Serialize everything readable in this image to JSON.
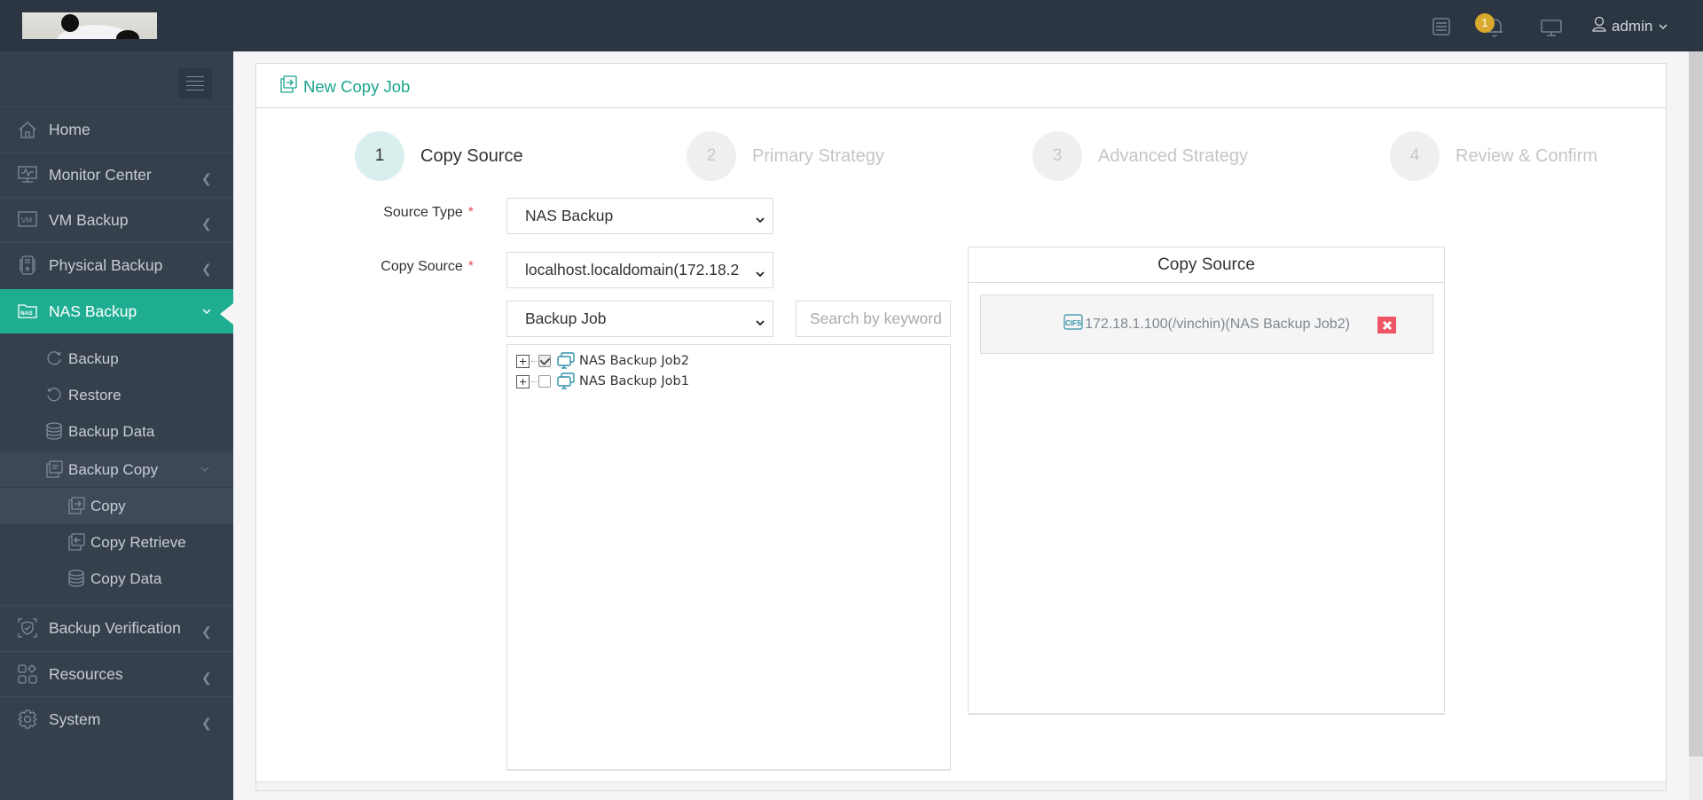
{
  "header": {
    "logo_alt": "panda logo",
    "notification_count": "1",
    "user_name": "admin",
    "icons": [
      "task-list-icon",
      "bell-icon",
      "monitor-icon",
      "user-icon",
      "chevron-down-icon"
    ]
  },
  "sidebar": {
    "items": [
      {
        "label": "Home",
        "icon": "home-icon"
      },
      {
        "label": "Monitor Center",
        "icon": "monitor-chart-icon"
      },
      {
        "label": "VM Backup",
        "icon": "vm-icon"
      },
      {
        "label": "Physical Backup",
        "icon": "server-icon"
      },
      {
        "label": "NAS Backup",
        "icon": "nas-icon",
        "active": true
      },
      {
        "label": "Backup Verification",
        "icon": "shield-check-icon"
      },
      {
        "label": "Resources",
        "icon": "grid-icon"
      },
      {
        "label": "System",
        "icon": "gear-icon"
      }
    ],
    "nas_sub": [
      {
        "label": "Backup",
        "icon": "refresh-icon"
      },
      {
        "label": "Restore",
        "icon": "undo-icon"
      },
      {
        "label": "Backup Data",
        "icon": "database-icon"
      },
      {
        "label": "Backup Copy",
        "icon": "copy-icon"
      }
    ],
    "copy_sub": [
      {
        "label": "Copy",
        "icon": "copy-arrow-icon",
        "current": true
      },
      {
        "label": "Copy Retrieve",
        "icon": "copy-retrieve-icon"
      },
      {
        "label": "Copy Data",
        "icon": "database-icon"
      }
    ]
  },
  "page": {
    "title": "New Copy Job",
    "steps": [
      {
        "number": "1",
        "label": "Copy Source",
        "active": true
      },
      {
        "number": "2",
        "label": "Primary Strategy"
      },
      {
        "number": "3",
        "label": "Advanced Strategy"
      },
      {
        "number": "4",
        "label": "Review & Confirm"
      }
    ],
    "form": {
      "source_type_label": "Source Type",
      "source_type_value": "NAS Backup",
      "copy_source_label": "Copy Source",
      "copy_source_value": "localhost.localdomain(172.18.2",
      "filter_value": "Backup Job",
      "search_placeholder": "Search by keyword",
      "required_mark": "*"
    },
    "tree": [
      {
        "label": "NAS Backup Job2",
        "checked": true
      },
      {
        "label": "NAS Backup Job1",
        "checked": false
      }
    ],
    "selected_panel": {
      "title": "Copy Source",
      "items": [
        {
          "icon": "cifs-icon",
          "text": "172.18.1.100(/vinchin)(NAS Backup Job2)"
        }
      ]
    }
  }
}
